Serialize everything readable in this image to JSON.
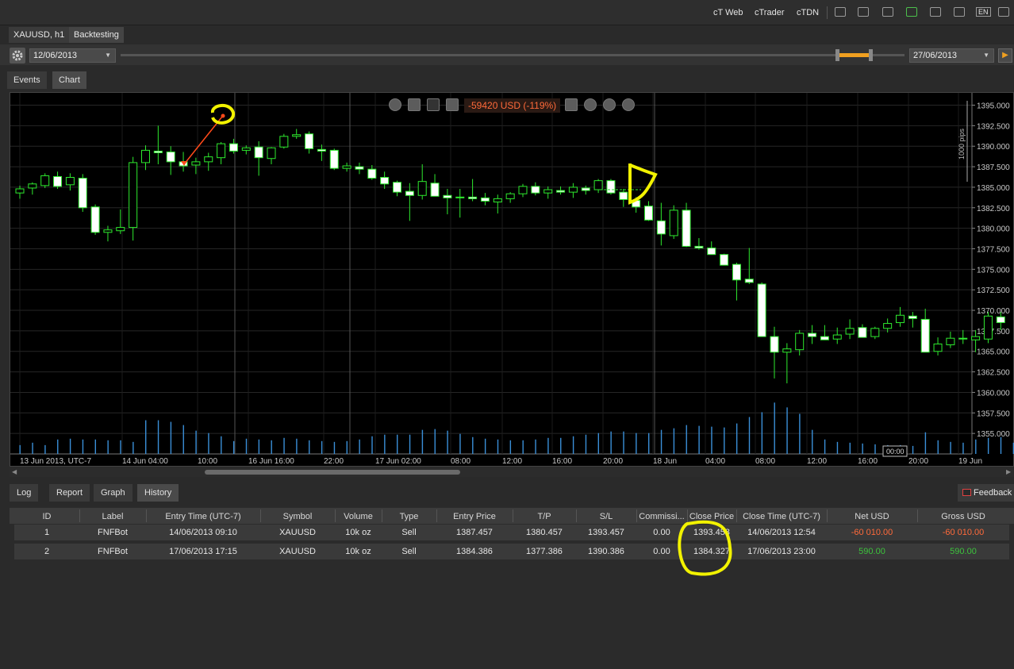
{
  "header": {
    "links": [
      "cT Web",
      "cTrader",
      "cTDN"
    ],
    "lang": "EN"
  },
  "symbol_tabs": [
    "XAUUSD, h1",
    "Backtesting"
  ],
  "range": {
    "start_date": "12/06/2013",
    "end_date": "27/06/2013"
  },
  "chart_tabs": [
    "Events",
    "Chart"
  ],
  "chart_toolbar": {
    "pnl": "-59420 USD (-119%)"
  },
  "bottom_tabs": [
    "Log",
    "Report",
    "Graph",
    "History"
  ],
  "feedback_label": "Feedback",
  "history": {
    "columns": [
      "ID",
      "Label",
      "Entry Time (UTC-7)",
      "Symbol",
      "Volume",
      "Type",
      "Entry Price",
      "T/P",
      "S/L",
      "Commissi...",
      "Close Price",
      "Close Time (UTC-7)",
      "Net USD",
      "Gross USD"
    ],
    "rows": [
      [
        "1",
        "FNFBot",
        "14/06/2013 09:10",
        "XAUUSD",
        "10k oz",
        "Sell",
        "1387.457",
        "1380.457",
        "1393.457",
        "0.00",
        "1393.458",
        "14/06/2013 12:54",
        "-60 010.00",
        "-60 010.00"
      ],
      [
        "2",
        "FNFBot",
        "17/06/2013 17:15",
        "XAUUSD",
        "10k oz",
        "Sell",
        "1384.386",
        "1377.386",
        "1390.386",
        "0.00",
        "1384.327",
        "17/06/2013 23:00",
        "590.00",
        "590.00"
      ]
    ],
    "colors": {
      "negative": "#ff6a3a",
      "positive": "#3cc23c"
    }
  },
  "chart_data": {
    "type": "candlestick",
    "ylim": [
      1352.5,
      1396.5
    ],
    "y_ticks": [
      "1395.000",
      "1392.500",
      "1390.000",
      "1387.500",
      "1385.000",
      "1382.500",
      "1380.000",
      "1377.500",
      "1375.000",
      "1372.500",
      "1370.000",
      "1367.500",
      "1365.000",
      "1362.500",
      "1360.000",
      "1357.500",
      "1355.000"
    ],
    "x_ticks": [
      "13 Jun 2013, UTC-7",
      "14 Jun 04:00",
      "10:00",
      "16 Jun 16:00",
      "22:00",
      "17 Jun 02:00",
      "08:00",
      "12:00",
      "16:00",
      "20:00",
      "18 Jun",
      "04:00",
      "08:00",
      "12:00",
      "16:00",
      "20:00",
      "19 Jun"
    ],
    "scale_label": "1000 pips",
    "cursor_time": "00:00",
    "colors": {
      "bull": "#2eea2e",
      "bear": "#ffffff",
      "volume": "#3a8fd8",
      "annotation": "#f2f200",
      "trade_line": "#ff4a1a"
    },
    "candles": [
      [
        1384.3,
        1385.2,
        1383.6,
        1384.8
      ],
      [
        1384.9,
        1385.6,
        1384.1,
        1385.4
      ],
      [
        1385.2,
        1386.7,
        1384.9,
        1386.4
      ],
      [
        1386.3,
        1386.9,
        1384.8,
        1385.1
      ],
      [
        1385.3,
        1386.7,
        1384.6,
        1386.2
      ],
      [
        1386.1,
        1386.6,
        1382.0,
        1382.5
      ],
      [
        1382.6,
        1382.9,
        1379.2,
        1379.5
      ],
      [
        1379.5,
        1380.3,
        1378.4,
        1379.8
      ],
      [
        1379.7,
        1382.3,
        1379.3,
        1380.1
      ],
      [
        1380.1,
        1388.7,
        1378.5,
        1388.0
      ],
      [
        1388.0,
        1390.1,
        1387.1,
        1389.5
      ],
      [
        1389.4,
        1392.5,
        1387.8,
        1389.2
      ],
      [
        1389.3,
        1390.0,
        1386.5,
        1388.1
      ],
      [
        1388.1,
        1389.3,
        1386.9,
        1387.6
      ],
      [
        1387.7,
        1388.6,
        1386.6,
        1388.1
      ],
      [
        1388.1,
        1389.2,
        1387.0,
        1388.7
      ],
      [
        1388.6,
        1390.5,
        1387.8,
        1390.3
      ],
      [
        1390.3,
        1390.9,
        1389.1,
        1389.4
      ],
      [
        1389.5,
        1390.1,
        1389.0,
        1389.8
      ],
      [
        1389.9,
        1390.6,
        1386.4,
        1388.6
      ],
      [
        1388.5,
        1389.9,
        1387.8,
        1389.8
      ],
      [
        1389.9,
        1391.5,
        1389.7,
        1391.2
      ],
      [
        1391.2,
        1392.1,
        1390.9,
        1391.4
      ],
      [
        1391.5,
        1391.8,
        1389.1,
        1389.7
      ],
      [
        1389.6,
        1390.2,
        1388.2,
        1389.4
      ],
      [
        1389.5,
        1389.7,
        1387.1,
        1387.3
      ],
      [
        1387.3,
        1388.0,
        1386.9,
        1387.6
      ],
      [
        1387.5,
        1388.0,
        1386.6,
        1387.2
      ],
      [
        1387.2,
        1387.7,
        1385.9,
        1386.1
      ],
      [
        1386.2,
        1386.9,
        1384.8,
        1385.4
      ],
      [
        1385.6,
        1385.8,
        1383.9,
        1384.4
      ],
      [
        1384.5,
        1385.5,
        1380.9,
        1384.0
      ],
      [
        1384.0,
        1387.8,
        1383.5,
        1385.7
      ],
      [
        1385.5,
        1386.6,
        1384.4,
        1383.9
      ],
      [
        1384.0,
        1384.8,
        1381.7,
        1383.7
      ],
      [
        1383.8,
        1384.8,
        1381.3,
        1383.8
      ],
      [
        1383.8,
        1386.0,
        1383.3,
        1383.6
      ],
      [
        1383.7,
        1384.3,
        1382.8,
        1383.3
      ],
      [
        1383.2,
        1384.1,
        1381.8,
        1383.6
      ],
      [
        1383.6,
        1384.4,
        1383.1,
        1384.2
      ],
      [
        1384.2,
        1385.4,
        1383.8,
        1385.1
      ],
      [
        1385.1,
        1385.6,
        1384.0,
        1384.3
      ],
      [
        1384.3,
        1385.1,
        1383.6,
        1384.7
      ],
      [
        1384.6,
        1385.1,
        1384.1,
        1384.4
      ],
      [
        1384.4,
        1385.5,
        1383.7,
        1385.0
      ],
      [
        1384.9,
        1385.2,
        1384.1,
        1384.6
      ],
      [
        1384.7,
        1386.0,
        1384.3,
        1385.8
      ],
      [
        1385.8,
        1386.0,
        1384.1,
        1384.3
      ],
      [
        1384.4,
        1384.8,
        1382.6,
        1383.5
      ],
      [
        1383.4,
        1383.8,
        1381.9,
        1382.6
      ],
      [
        1382.7,
        1383.3,
        1380.9,
        1381.0
      ],
      [
        1380.9,
        1383.1,
        1377.9,
        1379.3
      ],
      [
        1379.1,
        1382.8,
        1378.7,
        1382.2
      ],
      [
        1382.2,
        1383.1,
        1377.7,
        1377.8
      ],
      [
        1377.8,
        1378.8,
        1377.4,
        1377.6
      ],
      [
        1377.6,
        1378.4,
        1376.9,
        1376.8
      ],
      [
        1376.8,
        1376.9,
        1375.7,
        1375.5
      ],
      [
        1375.6,
        1375.8,
        1371.2,
        1373.7
      ],
      [
        1373.8,
        1377.6,
        1373.2,
        1373.4
      ],
      [
        1373.2,
        1373.4,
        1367.7,
        1366.8
      ],
      [
        1366.8,
        1368.0,
        1361.7,
        1364.9
      ],
      [
        1364.9,
        1366.0,
        1361.1,
        1365.3
      ],
      [
        1365.2,
        1367.6,
        1364.5,
        1367.2
      ],
      [
        1367.2,
        1368.2,
        1365.9,
        1366.8
      ],
      [
        1366.8,
        1368.2,
        1366.4,
        1366.4
      ],
      [
        1366.5,
        1367.9,
        1365.9,
        1367.0
      ],
      [
        1367.1,
        1368.9,
        1366.5,
        1367.8
      ],
      [
        1367.9,
        1368.3,
        1366.8,
        1366.7
      ],
      [
        1366.8,
        1368.0,
        1366.5,
        1367.8
      ],
      [
        1367.8,
        1369.0,
        1367.3,
        1368.4
      ],
      [
        1368.5,
        1370.4,
        1368.0,
        1369.4
      ],
      [
        1369.3,
        1369.8,
        1367.9,
        1369.0
      ],
      [
        1368.9,
        1370.2,
        1367.1,
        1364.9
      ],
      [
        1365.0,
        1366.7,
        1364.5,
        1365.9
      ],
      [
        1365.8,
        1367.4,
        1365.4,
        1366.6
      ],
      [
        1366.6,
        1367.6,
        1365.9,
        1366.5
      ],
      [
        1366.4,
        1367.6,
        1364.9,
        1366.8
      ],
      [
        1366.5,
        1369.8,
        1366.0,
        1369.3
      ],
      [
        1369.2,
        1369.8,
        1367.6,
        1368.5
      ]
    ],
    "volumes": [
      11,
      14,
      11,
      18,
      19,
      18,
      18,
      17,
      17,
      15,
      42,
      42,
      40,
      36,
      29,
      26,
      22,
      16,
      19,
      18,
      17,
      20,
      19,
      17,
      16,
      15,
      16,
      18,
      22,
      24,
      24,
      24,
      30,
      31,
      29,
      25,
      21,
      19,
      18,
      17,
      17,
      18,
      20,
      20,
      22,
      24,
      26,
      28,
      28,
      26,
      26,
      30,
      32,
      36,
      35,
      34,
      33,
      38,
      46,
      52,
      64,
      58,
      50,
      30,
      18,
      15,
      14,
      13,
      12,
      11,
      11,
      10,
      27,
      17,
      15,
      14,
      18,
      20,
      21,
      14
    ]
  }
}
